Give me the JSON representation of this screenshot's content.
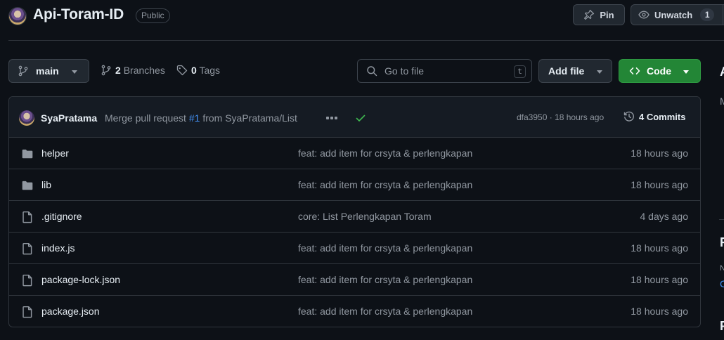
{
  "repo": {
    "name": "Api-Toram-ID",
    "visibility": "Public"
  },
  "header_actions": {
    "pin_label": "Pin",
    "watch_label": "Unwatch",
    "watch_count": "1"
  },
  "toolbar": {
    "branch": "main",
    "branches_count": "2",
    "branches_label": "Branches",
    "tags_count": "0",
    "tags_label": "Tags",
    "goto_placeholder": "Go to file",
    "goto_shortcut": "t",
    "add_file_label": "Add file",
    "code_label": "Code"
  },
  "latest_commit": {
    "author": "SyaPratama",
    "message_prefix": "Merge pull request",
    "pr_link": "#1",
    "message_suffix": "from SyaPratama/List",
    "sha": "dfa3950",
    "time": "18 hours ago",
    "commits_count": "4 Commits"
  },
  "files": [
    {
      "type": "dir",
      "icon": "folder-icon",
      "name": "helper",
      "commit": "feat: add item for crsyta & perlengkapan",
      "date": "18 hours ago"
    },
    {
      "type": "dir",
      "icon": "folder-icon",
      "name": "lib",
      "commit": "feat: add item for crsyta & perlengkapan",
      "date": "18 hours ago"
    },
    {
      "type": "file",
      "icon": "file-icon",
      "name": ".gitignore",
      "commit": "core: List Perlengkapan Toram",
      "date": "4 days ago"
    },
    {
      "type": "file",
      "icon": "file-icon",
      "name": "index.js",
      "commit": "feat: add item for crsyta & perlengkapan",
      "date": "18 hours ago"
    },
    {
      "type": "file",
      "icon": "file-icon",
      "name": "package-lock.json",
      "commit": "feat: add item for crsyta & perlengkapan",
      "date": "18 hours ago"
    },
    {
      "type": "file",
      "icon": "file-icon",
      "name": "package.json",
      "commit": "feat: add item for crsyta & perlengkapan",
      "date": "18 hours ago"
    }
  ],
  "sidebar_peek": {
    "about_initial": "A",
    "mute_1": "M",
    "releases_initial": "R",
    "mute_2": "N",
    "link_char": "C",
    "packages_initial": "P"
  },
  "colors": {
    "background": "#0d1117",
    "border": "#30363d",
    "code_button": "#238636",
    "link": "#4493f8",
    "success": "#3fb950"
  }
}
